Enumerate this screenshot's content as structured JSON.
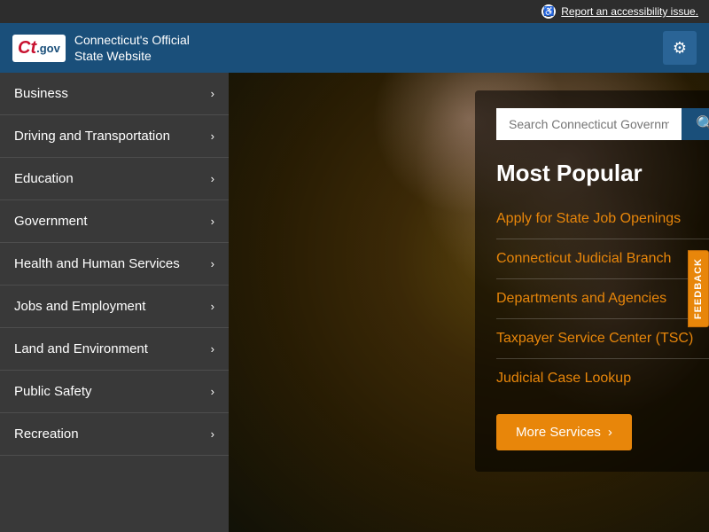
{
  "topbar": {
    "accessibility_label": "Report an accessibility issue."
  },
  "header": {
    "logo_ct": "Ct",
    "logo_gov": ".gov",
    "site_title_line1": "Connecticut's Official",
    "site_title_line2": "State Website",
    "settings_icon": "⚙"
  },
  "sidebar": {
    "items": [
      {
        "label": "Business",
        "id": "business"
      },
      {
        "label": "Driving and Transportation",
        "id": "driving"
      },
      {
        "label": "Education",
        "id": "education"
      },
      {
        "label": "Government",
        "id": "government"
      },
      {
        "label": "Health and Human Services",
        "id": "health"
      },
      {
        "label": "Jobs and Employment",
        "id": "jobs"
      },
      {
        "label": "Land and Environment",
        "id": "land"
      },
      {
        "label": "Public Safety",
        "id": "public-safety"
      },
      {
        "label": "Recreation",
        "id": "recreation"
      }
    ]
  },
  "search": {
    "placeholder": "Search Connecticut Government...",
    "icon": "🔍"
  },
  "most_popular": {
    "title": "Most Popular",
    "items": [
      {
        "label": "Apply for State Job Openings",
        "id": "jobs-link"
      },
      {
        "label": "Connecticut Judicial Branch",
        "id": "judicial-link"
      },
      {
        "label": "Departments and Agencies",
        "id": "departments-link"
      },
      {
        "label": "Taxpayer Service Center (TSC)",
        "id": "taxpayer-link"
      },
      {
        "label": "Judicial Case Lookup",
        "id": "judicial-case-link"
      }
    ],
    "more_services_label": "More Services"
  },
  "feedback": {
    "label": "FEEDBACK"
  }
}
